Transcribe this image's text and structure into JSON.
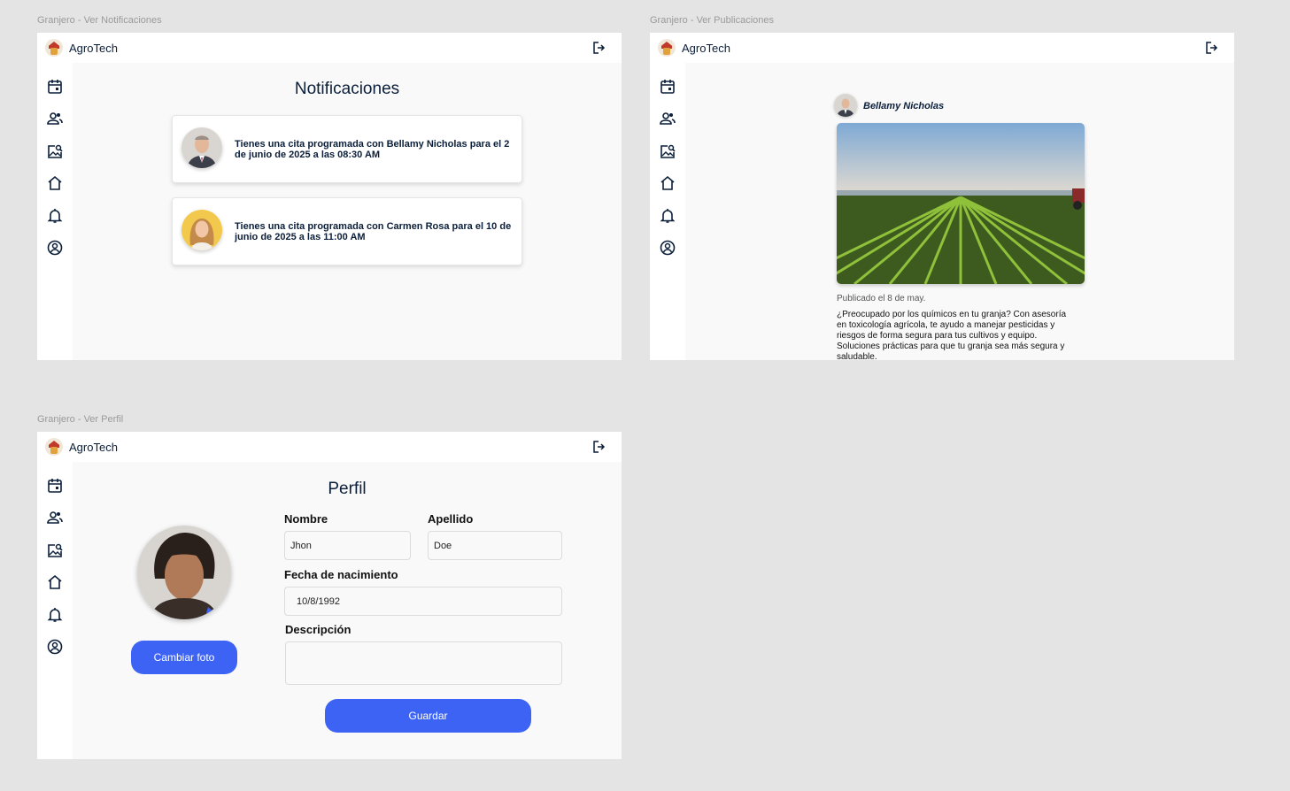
{
  "app": {
    "brand": "AgroTech"
  },
  "frames": {
    "notificaciones": {
      "label": "Granjero - Ver Notificaciones",
      "title": "Notificaciones",
      "items": [
        {
          "text": "Tienes una cita programada con Bellamy Nicholas para el 2 de junio de 2025 a las 08:30 AM",
          "avatar": "man-avatar"
        },
        {
          "text": "Tienes una cita programada con Carmen Rosa para el 10 de junio de 2025 a las 11:00 AM",
          "avatar": "woman-avatar"
        }
      ]
    },
    "publicaciones": {
      "label": "Granjero - Ver Publicaciones",
      "author": "Bellamy Nicholas",
      "date": "Publicado el 8 de may.",
      "text": "¿Preocupado por los químicos en tu granja? Con asesoría en toxicología agrícola, te ayudo a manejar pesticidas y riesgos de forma segura para tus cultivos y equipo. Soluciones prácticas para que tu granja sea más segura y saludable."
    },
    "perfil": {
      "label": "Granjero - Ver Perfil",
      "title": "Perfil",
      "nombre_label": "Nombre",
      "nombre_value": "Jhon",
      "apellido_label": "Apellido",
      "apellido_value": "Doe",
      "fecha_label": "Fecha de nacimiento",
      "fecha_value": "10/8/1992",
      "descripcion_label": "Descripción",
      "descripcion_value": "",
      "change_photo": "Cambiar foto",
      "save": "Guardar"
    }
  },
  "sidebar_icons": [
    "calendar-icon",
    "users-icon",
    "image-search-icon",
    "home-icon",
    "bell-icon",
    "profile-icon"
  ],
  "colors": {
    "primary": "#3d63f5",
    "text": "#0b1f3a",
    "background": "#e4e4e4",
    "frame": "#f9f9f9"
  }
}
